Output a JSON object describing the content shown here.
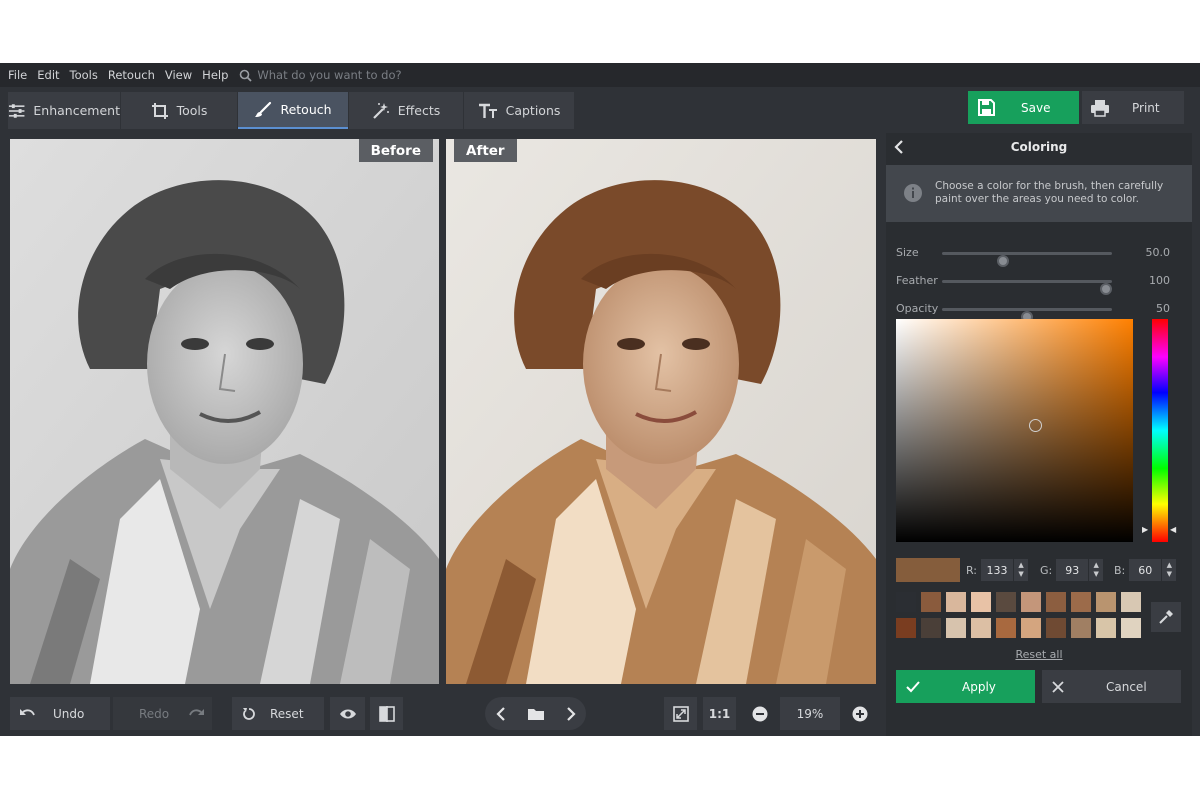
{
  "menu": {
    "items": [
      "File",
      "Edit",
      "Tools",
      "Retouch",
      "View",
      "Help"
    ],
    "search_placeholder": "What do you want to do?"
  },
  "tabs": [
    {
      "label": "Enhancement",
      "icon": "sliders-icon"
    },
    {
      "label": "Tools",
      "icon": "crop-icon"
    },
    {
      "label": "Retouch",
      "icon": "brush-icon",
      "active": true
    },
    {
      "label": "Effects",
      "icon": "magic-wand-icon"
    },
    {
      "label": "Captions",
      "icon": "text-icon"
    }
  ],
  "toolbar": {
    "save_label": "Save",
    "print_label": "Print"
  },
  "panes": {
    "before_label": "Before",
    "after_label": "After"
  },
  "bottom": {
    "undo_label": "Undo",
    "redo_label": "Redo",
    "reset_label": "Reset",
    "zoom_fit_label": "1:1",
    "zoom_percent": "19%"
  },
  "panel": {
    "title": "Coloring",
    "info_text": "Choose a color for the brush, then carefully paint over the areas you need to color.",
    "sliders": [
      {
        "label": "Size",
        "value": "50.0",
        "fraction": 0.35
      },
      {
        "label": "Feather",
        "value": "100",
        "fraction": 1.0
      },
      {
        "label": "Opacity",
        "value": "50",
        "fraction": 0.5
      }
    ],
    "color": {
      "r_label": "R:",
      "g_label": "G:",
      "b_label": "B:",
      "r": "133",
      "g": "93",
      "b": "60",
      "hex": "#855d3c"
    },
    "palette": [
      "#2b2e33",
      "#8a5b3d",
      "#d9b79c",
      "#e8c2a6",
      "#5a4a3f",
      "#c4967a",
      "#8c5e40",
      "#9c6b4a",
      "#b9946f",
      "#d8c8b3",
      "#7a3d20",
      "#4a3f38",
      "#d7c3ad",
      "#dcbfa4",
      "#a8693f",
      "#d4a57f",
      "#6f4a33",
      "#a07f63",
      "#d8c5a8",
      "#e0d3c0"
    ],
    "reset_all_label": "Reset all",
    "apply_label": "Apply",
    "cancel_label": "Cancel"
  },
  "colors": {
    "accent_green": "#17a05c",
    "active_tab": "#4a5361",
    "panel_bg": "#2a2d31"
  }
}
